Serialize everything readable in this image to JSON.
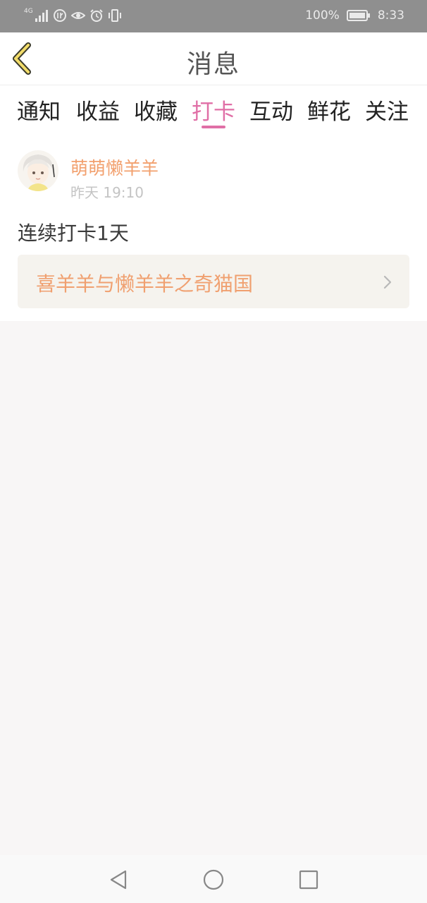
{
  "status_bar": {
    "network": "4G",
    "battery_percent": "100%",
    "time": "8:33"
  },
  "header": {
    "title": "消息"
  },
  "tabs": [
    {
      "label": "通知",
      "active": false
    },
    {
      "label": "收益",
      "active": false
    },
    {
      "label": "收藏",
      "active": false
    },
    {
      "label": "打卡",
      "active": true
    },
    {
      "label": "互动",
      "active": false
    },
    {
      "label": "鲜花",
      "active": false
    },
    {
      "label": "关注",
      "active": false
    }
  ],
  "message": {
    "username": "萌萌懒羊羊",
    "time": "昨天 19:10",
    "text": "连续打卡1天",
    "book_title": "喜羊羊与懒羊羊之奇猫国"
  },
  "colors": {
    "accent": "#e06fa6",
    "username": "#f2a06e",
    "book_title": "#f0a070",
    "status_bar_bg": "#8f8f8f"
  },
  "icons": {
    "back": "back-arrow-icon",
    "chevron": "chevron-right-icon",
    "nav_back": "triangle-back-icon",
    "nav_home": "circle-home-icon",
    "nav_recent": "square-recents-icon"
  }
}
